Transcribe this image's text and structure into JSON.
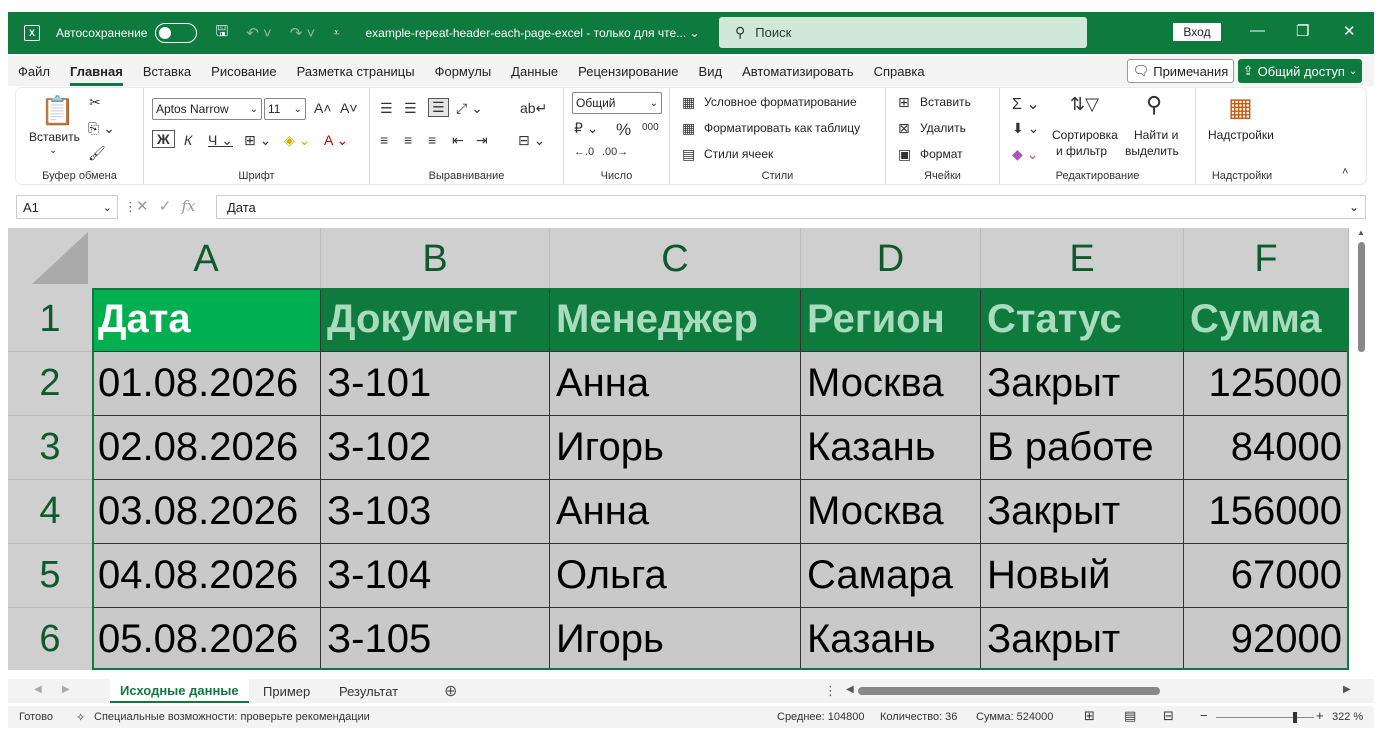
{
  "titlebar": {
    "autosave_label": "Автосохранение",
    "doc_title": "example-repeat-header-each-page-excel  -  только для чте... ⌄",
    "search_placeholder": "Поиск",
    "signin_label": "Вход"
  },
  "tabs": [
    "Файл",
    "Главная",
    "Вставка",
    "Рисование",
    "Разметка страницы",
    "Формулы",
    "Данные",
    "Рецензирование",
    "Вид",
    "Автоматизировать",
    "Справка"
  ],
  "comments_label": "Примечания",
  "share_label": "Общий доступ",
  "ribbon": {
    "clipboard": {
      "paste_label": "Вставить",
      "group_label": "Буфер обмена"
    },
    "font": {
      "font_name": "Aptos Narrow",
      "font_size": "11",
      "group_label": "Шрифт"
    },
    "alignment": {
      "group_label": "Выравнивание"
    },
    "number": {
      "format": "Общий",
      "group_label": "Число"
    },
    "styles": {
      "cond_format": "Условное форматирование",
      "format_table": "Форматировать как таблицу",
      "cell_styles": "Стили ячеек",
      "group_label": "Стили"
    },
    "cells": {
      "insert": "Вставить",
      "delete": "Удалить",
      "format": "Формат",
      "group_label": "Ячейки"
    },
    "editing": {
      "sort_l1": "Сортировка",
      "sort_l2": "и фильтр",
      "find_l1": "Найти и",
      "find_l2": "выделить",
      "group_label": "Редактирование"
    },
    "addins": {
      "label": "Надстройки",
      "group_label": "Надстройки"
    }
  },
  "formula_bar": {
    "namebox": "A1",
    "content": "Дата"
  },
  "grid": {
    "columns": [
      "A",
      "B",
      "C",
      "D",
      "E",
      "F"
    ],
    "rows": [
      "1",
      "2",
      "3",
      "4",
      "5",
      "6"
    ],
    "header": [
      "Дата",
      "Документ",
      "Менеджер",
      "Регион",
      "Статус",
      "Сумма"
    ],
    "data": [
      [
        "01.08.2026",
        "З-101",
        "Анна",
        "Москва",
        "Закрыт",
        "125000"
      ],
      [
        "02.08.2026",
        "З-102",
        "Игорь",
        "Казань",
        "В работе",
        "84000"
      ],
      [
        "03.08.2026",
        "З-103",
        "Анна",
        "Москва",
        "Закрыт",
        "156000"
      ],
      [
        "04.08.2026",
        "З-104",
        "Ольга",
        "Самара",
        "Новый",
        "67000"
      ],
      [
        "05.08.2026",
        "З-105",
        "Игорь",
        "Казань",
        "Закрыт",
        "92000"
      ]
    ]
  },
  "sheets": [
    "Исходные данные",
    "Пример",
    "Результат"
  ],
  "status": {
    "ready": "Готово",
    "accessibility": "Специальные возможности: проверьте рекомендации",
    "average": "Среднее: 104800",
    "count": "Количество: 36",
    "sum": "Сумма: 524000",
    "zoom": "322 %"
  },
  "colors": {
    "accent": "#0e7a3e",
    "header_first": "#00b050"
  }
}
